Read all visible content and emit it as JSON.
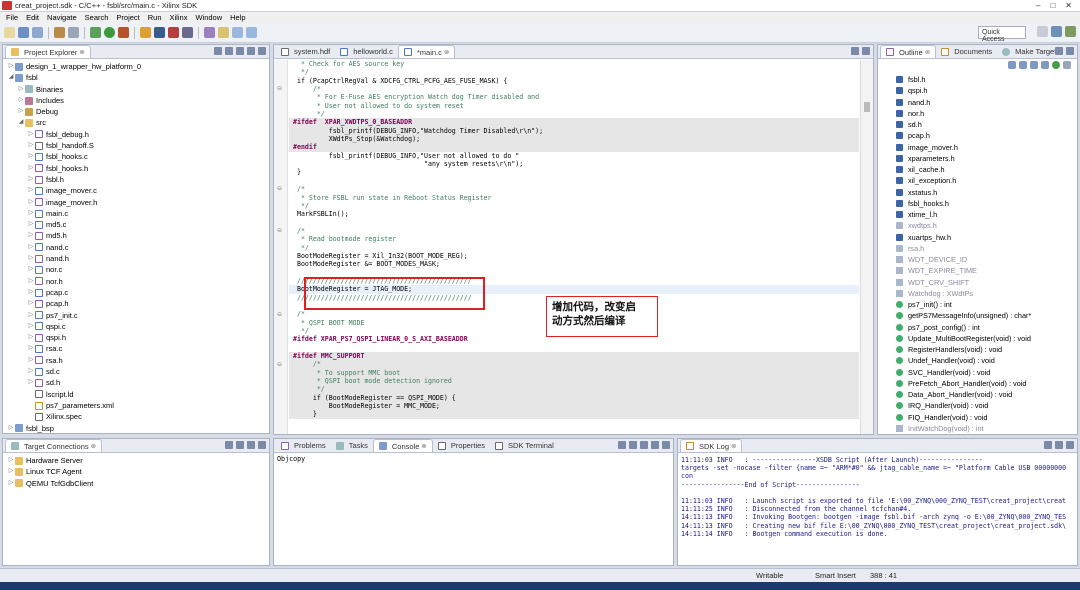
{
  "window": {
    "title": "creat_project.sdk - C/C++ - fsbl/src/main.c - Xilinx SDK"
  },
  "menu": [
    "File",
    "Edit",
    "Navigate",
    "Search",
    "Project",
    "Run",
    "Xilinx",
    "Window",
    "Help"
  ],
  "toolbar": {
    "quick_access": "Quick Access"
  },
  "project_explorer": {
    "tab": "Project Explorer",
    "items": [
      {
        "indent": 0,
        "arrow": "▷",
        "icon": "proj",
        "label": "design_1_wrapper_hw_platform_0"
      },
      {
        "indent": 0,
        "arrow": "◢",
        "icon": "proj",
        "label": "fsbl"
      },
      {
        "indent": 1,
        "arrow": "▷",
        "icon": "bin",
        "label": "Binaries"
      },
      {
        "indent": 1,
        "arrow": "▷",
        "icon": "inc",
        "label": "Includes"
      },
      {
        "indent": 1,
        "arrow": "▷",
        "icon": "dbg",
        "label": "Debug"
      },
      {
        "indent": 1,
        "arrow": "◢",
        "icon": "folder",
        "label": "src"
      },
      {
        "indent": 2,
        "arrow": "▷",
        "icon": "hfile",
        "label": "fsbl_debug.h"
      },
      {
        "indent": 2,
        "arrow": "▷",
        "icon": "sfile",
        "label": "fsbl_handoff.S"
      },
      {
        "indent": 2,
        "arrow": "▷",
        "icon": "cfile",
        "label": "fsbl_hooks.c"
      },
      {
        "indent": 2,
        "arrow": "▷",
        "icon": "hfile",
        "label": "fsbl_hooks.h"
      },
      {
        "indent": 2,
        "arrow": "▷",
        "icon": "hfile",
        "label": "fsbl.h"
      },
      {
        "indent": 2,
        "arrow": "▷",
        "icon": "cfile",
        "label": "image_mover.c"
      },
      {
        "indent": 2,
        "arrow": "▷",
        "icon": "hfile",
        "label": "image_mover.h"
      },
      {
        "indent": 2,
        "arrow": "▷",
        "icon": "cfile",
        "label": "main.c"
      },
      {
        "indent": 2,
        "arrow": "▷",
        "icon": "cfile",
        "label": "md5.c"
      },
      {
        "indent": 2,
        "arrow": "▷",
        "icon": "hfile",
        "label": "md5.h"
      },
      {
        "indent": 2,
        "arrow": "▷",
        "icon": "cfile",
        "label": "nand.c"
      },
      {
        "indent": 2,
        "arrow": "▷",
        "icon": "hfile",
        "label": "nand.h"
      },
      {
        "indent": 2,
        "arrow": "▷",
        "icon": "cfile",
        "label": "nor.c"
      },
      {
        "indent": 2,
        "arrow": "▷",
        "icon": "hfile",
        "label": "nor.h"
      },
      {
        "indent": 2,
        "arrow": "▷",
        "icon": "cfile",
        "label": "pcap.c"
      },
      {
        "indent": 2,
        "arrow": "▷",
        "icon": "hfile",
        "label": "pcap.h"
      },
      {
        "indent": 2,
        "arrow": "▷",
        "icon": "cfile",
        "label": "ps7_init.c"
      },
      {
        "indent": 2,
        "arrow": "▷",
        "icon": "cfile",
        "label": "qspi.c"
      },
      {
        "indent": 2,
        "arrow": "▷",
        "icon": "hfile",
        "label": "qspi.h"
      },
      {
        "indent": 2,
        "arrow": "▷",
        "icon": "cfile",
        "label": "rsa.c"
      },
      {
        "indent": 2,
        "arrow": "▷",
        "icon": "hfile",
        "label": "rsa.h"
      },
      {
        "indent": 2,
        "arrow": "▷",
        "icon": "cfile",
        "label": "sd.c"
      },
      {
        "indent": 2,
        "arrow": "▷",
        "icon": "hfile",
        "label": "sd.h"
      },
      {
        "indent": 2,
        "arrow": "",
        "icon": "sfile",
        "label": "lscript.ld"
      },
      {
        "indent": 2,
        "arrow": "",
        "icon": "xml",
        "label": "ps7_parameters.xml"
      },
      {
        "indent": 2,
        "arrow": "",
        "icon": "sfile",
        "label": "Xilinx.spec"
      },
      {
        "indent": 0,
        "arrow": "▷",
        "icon": "proj",
        "label": "fsbl_bsp"
      }
    ]
  },
  "editor": {
    "tabs": [
      "system.hdf",
      "helloworld.c",
      "*main.c"
    ],
    "lines": [
      {
        "t": "  * Check for AES source key",
        "c": "cm"
      },
      {
        "t": "  */",
        "c": "cm"
      },
      {
        "t": " if (PcapCtrlRegVal & XDCFG_CTRL_PCFG_AES_FUSE_MASK) {",
        "c": ""
      },
      {
        "t": "     /*",
        "c": "cm",
        "fold": "⊖"
      },
      {
        "t": "      * For E-Fuse AES encryption Watch dog Timer disabled and",
        "c": "cm"
      },
      {
        "t": "      * User not allowed to do system reset",
        "c": "cm"
      },
      {
        "t": "      */",
        "c": "cm"
      },
      {
        "t": "#ifdef  XPAR_XWDTPS_0_BASEADDR",
        "c": "pp",
        "g": true
      },
      {
        "t": "         fsbl_printf(DEBUG_INFO,\"Watchdog Timer Disabled\\r\\n\");",
        "c": "",
        "g": true
      },
      {
        "t": "         XWdtPs_Stop(&Watchdog);",
        "c": "",
        "g": true
      },
      {
        "t": "#endif",
        "c": "pp",
        "g": true
      },
      {
        "t": "         fsbl_printf(DEBUG_INFO,\"User not allowed to do \"",
        "c": ""
      },
      {
        "t": "                                 \"any system resets\\r\\n\");",
        "c": ""
      },
      {
        "t": " }",
        "c": ""
      },
      {
        "t": "",
        "c": ""
      },
      {
        "t": " /*",
        "c": "cm",
        "fold": "⊖"
      },
      {
        "t": "  * Store FSBL run state in Reboot Status Register",
        "c": "cm"
      },
      {
        "t": "  */",
        "c": "cm"
      },
      {
        "t": " MarkFSBLIn();",
        "c": ""
      },
      {
        "t": "",
        "c": ""
      },
      {
        "t": " /*",
        "c": "cm",
        "fold": "⊖"
      },
      {
        "t": "  * Read bootmode register",
        "c": "cm"
      },
      {
        "t": "  */",
        "c": "cm"
      },
      {
        "t": " BootModeRegister = Xil_In32(BOOT_MODE_REG);",
        "c": ""
      },
      {
        "t": " BootModeRegister &= BOOT_MODES_MASK;",
        "c": ""
      },
      {
        "t": "",
        "c": ""
      },
      {
        "t": " ////////////////////////////////////////////",
        "c": "cm"
      },
      {
        "t": " BootModeRegister = JTAG_MODE;",
        "c": "",
        "cur": true
      },
      {
        "t": " ////////////////////////////////////////////",
        "c": "cm"
      },
      {
        "t": "",
        "c": ""
      },
      {
        "t": " /*",
        "c": "cm",
        "fold": "⊖"
      },
      {
        "t": "  * QSPI BOOT MODE",
        "c": "cm"
      },
      {
        "t": "  */",
        "c": "cm"
      },
      {
        "t": "#ifdef XPAR_PS7_QSPI_LINEAR_0_S_AXI_BASEADDR",
        "c": "pp"
      },
      {
        "t": "",
        "c": ""
      },
      {
        "t": "#ifdef MMC_SUPPORT",
        "c": "pp",
        "g": true
      },
      {
        "t": "     /*",
        "c": "cm",
        "g": true,
        "fold": "⊖"
      },
      {
        "t": "      * To support MMC boot",
        "c": "cm",
        "g": true
      },
      {
        "t": "      * QSPI boot mode detection ignored",
        "c": "cm",
        "g": true
      },
      {
        "t": "      */",
        "c": "cm",
        "g": true
      },
      {
        "t": "     if (BootModeRegister == QSPI_MODE) {",
        "c": "",
        "g": true
      },
      {
        "t": "         BootModeRegister = MMC_MODE;",
        "c": "",
        "g": true
      },
      {
        "t": "     }",
        "c": "",
        "g": true
      }
    ]
  },
  "annotation": {
    "line1": "增加代码，改变启",
    "line2": "动方式然后编译"
  },
  "outline": {
    "tabs": [
      "Outline",
      "Documents",
      "Make Target"
    ],
    "items": [
      {
        "k": "inc",
        "label": "fsbl.h"
      },
      {
        "k": "inc",
        "label": "qspi.h"
      },
      {
        "k": "inc",
        "label": "nand.h"
      },
      {
        "k": "inc",
        "label": "nor.h"
      },
      {
        "k": "inc",
        "label": "sd.h"
      },
      {
        "k": "inc",
        "label": "pcap.h"
      },
      {
        "k": "inc",
        "label": "image_mover.h"
      },
      {
        "k": "inc",
        "label": "xparameters.h"
      },
      {
        "k": "inc",
        "label": "xil_cache.h"
      },
      {
        "k": "inc",
        "label": "xil_exception.h"
      },
      {
        "k": "inc",
        "label": "xstatus.h"
      },
      {
        "k": "inc",
        "label": "fsbl_hooks.h"
      },
      {
        "k": "inc",
        "label": "xtime_l.h"
      },
      {
        "k": "incg",
        "label": "xwdtps.h"
      },
      {
        "k": "inc",
        "label": "xuartps_hw.h"
      },
      {
        "k": "incg",
        "label": "rsa.h"
      },
      {
        "k": "mac",
        "label": "WDT_DEVICE_ID"
      },
      {
        "k": "mac",
        "label": "WDT_EXPIRE_TIME"
      },
      {
        "k": "mac",
        "label": "WDT_CRV_SHIFT"
      },
      {
        "k": "mac",
        "label": "Watchdog : XWdtPs"
      },
      {
        "k": "fn",
        "label": "ps7_init() : int"
      },
      {
        "k": "fn",
        "label": "getPS7MessageInfo(unsigned) : char*"
      },
      {
        "k": "fn",
        "label": "ps7_post_config() : int"
      },
      {
        "k": "fn",
        "label": "Update_MultiBootRegister(void) : void"
      },
      {
        "k": "fn",
        "label": "RegisterHandlers(void) : void"
      },
      {
        "k": "fn",
        "label": "Undef_Handler(void) : void"
      },
      {
        "k": "fn",
        "label": "SVC_Handler(void) : void"
      },
      {
        "k": "fn",
        "label": "PreFetch_Abort_Handler(void) : void"
      },
      {
        "k": "fn",
        "label": "Data_Abort_Handler(void) : void"
      },
      {
        "k": "fn",
        "label": "IRQ_Handler(void) : void"
      },
      {
        "k": "fn",
        "label": "FIQ_Handler(void) : void"
      },
      {
        "k": "mac",
        "label": "InitWatchDog(void) : int"
      }
    ]
  },
  "target_connections": {
    "tab": "Target Connections",
    "items": [
      "Hardware Server",
      "Linux TCF Agent",
      "QEMU TcfGdbClient"
    ]
  },
  "console": {
    "tabs": [
      "Problems",
      "Tasks",
      "Console",
      "Properties",
      "SDK Terminal"
    ],
    "text": "Objcopy"
  },
  "sdk_log": {
    "tab": "SDK Log",
    "lines": [
      "11:11:03 INFO   : ----------------XSDB Script (After Launch)----------------",
      "targets -set -nocase -filter {name =~ \"ARM*#0\" && jtag_cable_name =~ \"Platform Cable USB 00000000",
      "con",
      "----------------End of Script----------------",
      "",
      "11:11:03 INFO   : Launch script is exported to file 'E:\\00_ZYNQ\\000_ZYNQ_TEST\\creat_project\\creat",
      "11:11:25 INFO   : Disconnected from the channel tcfchan#4.",
      "14:11:13 INFO   : Invoking Bootgen: bootgen -image fsbl.bif -arch zynq -o E:\\00_ZYNQ\\000_ZYNQ_TES",
      "14:11:13 INFO   : Creating new bif file E:\\00_ZYNQ\\000_ZYNQ_TEST\\creat_project\\creat_project.sdk\\",
      "14:11:14 INFO   : Bootgen command execution is done."
    ]
  },
  "status": {
    "mode": "Writable",
    "insert": "Smart Insert",
    "pos": "388 : 41"
  }
}
